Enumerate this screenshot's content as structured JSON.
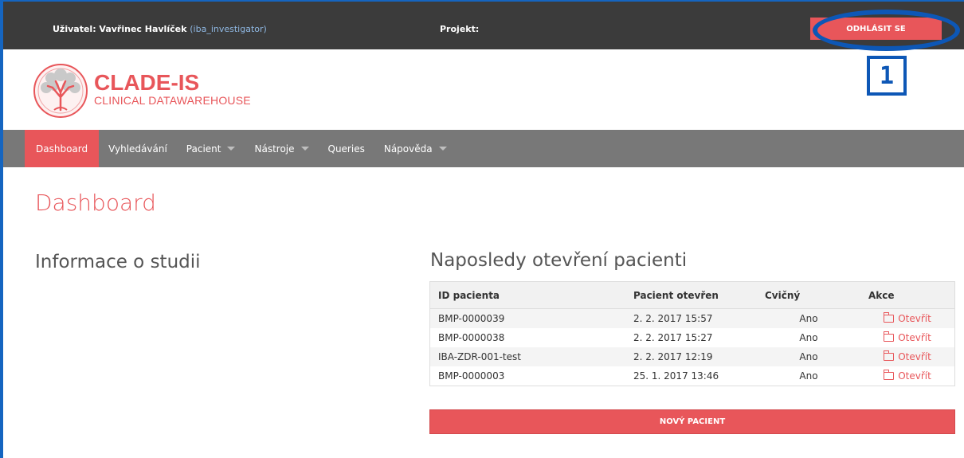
{
  "topbar": {
    "user_prefix": "Uživatel: Vavřinec Havlíček",
    "user_login": "(iba_investigator)",
    "project_label": "Projekt:",
    "logout_label": "ODHLÁSIT SE"
  },
  "annotation": {
    "badge": "1"
  },
  "brand": {
    "name": "CLADE-IS",
    "subtitle": "CLINICAL DATAWAREHOUSE"
  },
  "nav": {
    "items": [
      {
        "label": "Dashboard",
        "active": true
      },
      {
        "label": "Vyhledávání"
      },
      {
        "label": "Pacient",
        "dropdown": true
      },
      {
        "label": "Nástroje",
        "dropdown": true
      },
      {
        "label": "Queries"
      },
      {
        "label": "Nápověda",
        "dropdown": true
      }
    ]
  },
  "page": {
    "title": "Dashboard",
    "info_title": "Informace o studii",
    "recent_title": "Naposledy otevření pacienti"
  },
  "recent_table": {
    "headers": [
      "ID pacienta",
      "Pacient otevřen",
      "Cvičný",
      "Akce"
    ],
    "rows": [
      {
        "id": "BMP-0000039",
        "opened": "2. 2. 2017 15:57",
        "practice": "Ano",
        "action": "Otevřít"
      },
      {
        "id": "BMP-0000038",
        "opened": "2. 2. 2017 15:27",
        "practice": "Ano",
        "action": "Otevřít"
      },
      {
        "id": "IBA-ZDR-001-test",
        "opened": "2. 2. 2017 12:19",
        "practice": "Ano",
        "action": "Otevřít"
      },
      {
        "id": "BMP-0000003",
        "opened": "25. 1. 2017 13:46",
        "practice": "Ano",
        "action": "Otevřít"
      }
    ]
  },
  "new_patient_label": "NOVÝ PACIENT",
  "colors": {
    "accent": "#e8565a",
    "topbar": "#3b3b3b",
    "nav": "#787878",
    "annotation": "#0d57b6"
  }
}
